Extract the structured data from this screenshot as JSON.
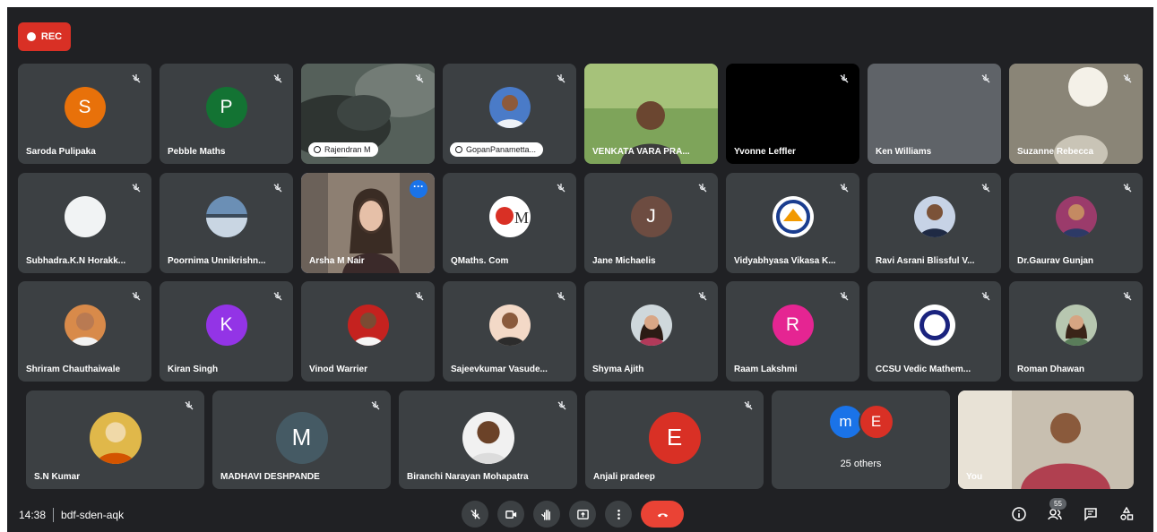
{
  "rec_label": "REC",
  "meeting": {
    "time": "14:38",
    "code": "bdf-sden-aqk"
  },
  "participants_count": "55",
  "tiles": [
    {
      "id": "saroda",
      "name": "Saroda Pulipaka",
      "initial": "S",
      "color": "#e8710a"
    },
    {
      "id": "pebble",
      "name": "Pebble Maths",
      "initial": "P",
      "color": "#137333"
    },
    {
      "id": "rajendran",
      "name": "Rajendran M"
    },
    {
      "id": "gopan",
      "name": "GopanPanametta..."
    },
    {
      "id": "venkata",
      "name": "VENKATA VARA PRA..."
    },
    {
      "id": "yvonne",
      "name": "Yvonne Leffler"
    },
    {
      "id": "ken",
      "name": "Ken Williams"
    },
    {
      "id": "suzanne",
      "name": "Suzanne Rebecca"
    },
    {
      "id": "subhadra",
      "name": "Subhadra.K.N Horakk..."
    },
    {
      "id": "poornima",
      "name": "Poornima Unnikrishn..."
    },
    {
      "id": "arsha",
      "name": "Arsha M Nair"
    },
    {
      "id": "qmaths",
      "name": "QMaths. Com"
    },
    {
      "id": "jane",
      "name": "Jane Michaelis",
      "initial": "J",
      "color": "#6d4c41"
    },
    {
      "id": "vidyabhyasa",
      "name": "Vidyabhyasa Vikasa K..."
    },
    {
      "id": "ravi",
      "name": "Ravi Asrani Blissful V..."
    },
    {
      "id": "gaurav",
      "name": "Dr.Gaurav Gunjan"
    },
    {
      "id": "shriram",
      "name": "Shriram Chauthaiwale"
    },
    {
      "id": "kiran",
      "name": "Kiran Singh",
      "initial": "K",
      "color": "#9334e6"
    },
    {
      "id": "vinod",
      "name": "Vinod Warrier"
    },
    {
      "id": "sajeev",
      "name": "Sajeevkumar Vasude..."
    },
    {
      "id": "shyma",
      "name": "Shyma Ajith"
    },
    {
      "id": "raam",
      "name": "Raam Lakshmi",
      "initial": "R",
      "color": "#e52592"
    },
    {
      "id": "ccsu",
      "name": "CCSU Vedic Mathem..."
    },
    {
      "id": "roman",
      "name": "Roman Dhawan"
    },
    {
      "id": "snkumar",
      "name": "S.N Kumar"
    },
    {
      "id": "madhavi",
      "name": "MADHAVI DESHPANDE",
      "initial": "M",
      "color": "#455a64"
    },
    {
      "id": "biranchi",
      "name": "Biranchi Narayan Mohapatra"
    },
    {
      "id": "anjali",
      "name": "Anjali pradeep",
      "initial": "E",
      "color": "#d93025"
    },
    {
      "id": "others",
      "name": "25 others",
      "initials": [
        "m",
        "E"
      ],
      "colors": [
        "#1a73e8",
        "#d93025"
      ]
    },
    {
      "id": "you",
      "name": "You"
    }
  ]
}
